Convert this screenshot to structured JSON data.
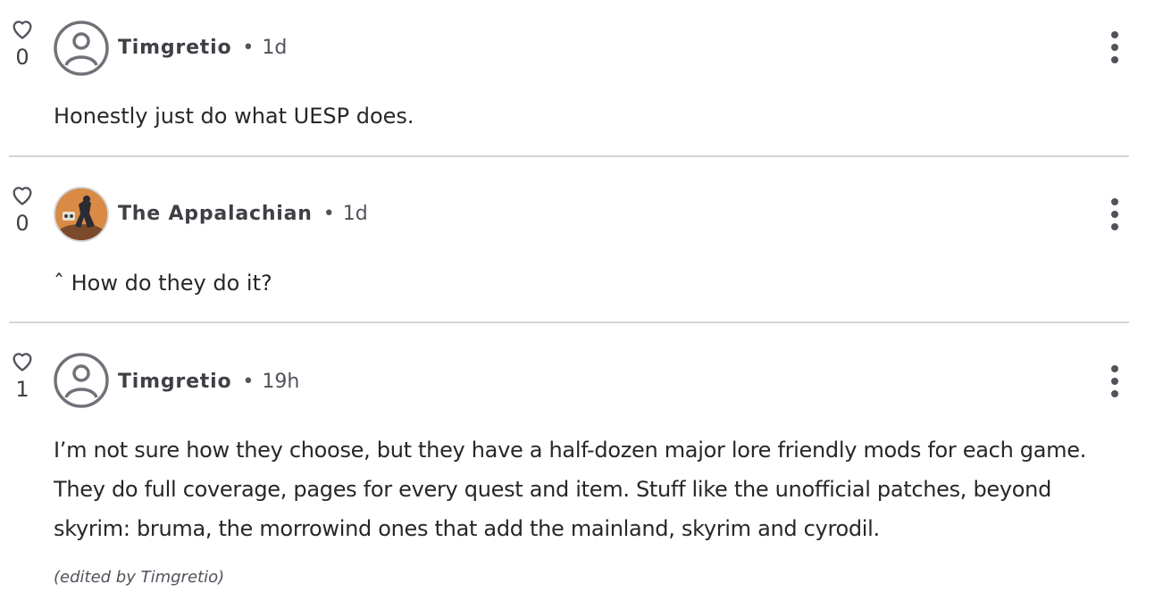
{
  "replies": [
    {
      "author": "Timgretio",
      "time": "1d",
      "separator": "•",
      "likes": "0",
      "avatar": "default-user-icon",
      "text": "Honestly just do what UESP does."
    },
    {
      "author": "The Appalachian",
      "time": "1d",
      "separator": "•",
      "likes": "0",
      "avatar": "profile-image",
      "text": "ˆ How do they do it?"
    },
    {
      "author": "Timgretio",
      "time": "19h",
      "separator": "•",
      "likes": "1",
      "avatar": "default-user-icon",
      "text": "I’m not sure how they choose, but they have a half-dozen major lore friendly mods for each game. They do full coverage, pages for every quest and item. Stuff like the unofficial patches, beyond skyrim: bruma, the morrowind ones that add the mainland, skyrim and cyrodil.",
      "edited_note": "(edited by Timgretio)"
    }
  ],
  "colors": {
    "text": "#27272a",
    "muted": "#52525b",
    "divider": "#d4d4d8",
    "icon": "#52525b"
  }
}
